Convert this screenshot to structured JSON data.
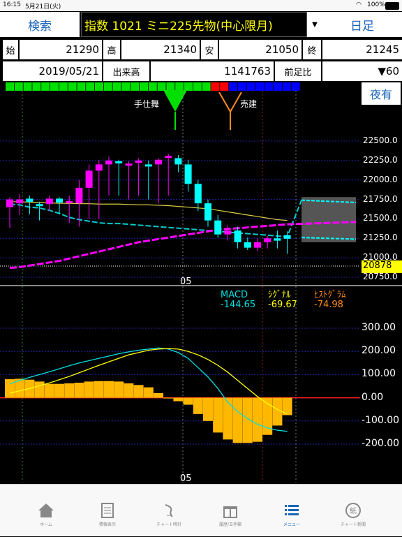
{
  "status_bar": {
    "time": "16:15",
    "date": "5月21日(火)",
    "battery": "100%"
  },
  "header": {
    "search_label": "検索",
    "instrument": "指数 1021 ミニ225先物(中心限月)",
    "period_label": "日足"
  },
  "quote": {
    "open_label": "始",
    "open": "21290",
    "high_label": "高",
    "high": "21340",
    "low_label": "安",
    "low": "21050",
    "close_label": "終",
    "close": "21245",
    "date": "2019/05/21",
    "volume_label": "出来高",
    "volume": "1141763",
    "change_label": "前足比",
    "change": "▼60"
  },
  "night_button": "夜有",
  "signals": {
    "buy": "手仕舞",
    "sell": "売建"
  },
  "price_chart": {
    "y_ticks": [
      "22500.0",
      "22250.0",
      "22000.0",
      "21750.0",
      "21500.0",
      "21250.0",
      "21000.0",
      "20750.0"
    ],
    "current_price": "20878",
    "x_label": "05"
  },
  "macd_panel": {
    "macd_label": "MACD",
    "macd_value": "-144.65",
    "signal_label": "ｼｸﾞﾅﾙ",
    "signal_value": "-69.67",
    "hist_label": "ﾋｽﾄｸﾞﾗﾑ",
    "hist_value": "-74.98",
    "y_ticks": [
      "300.00",
      "200.00",
      "100.00",
      "0.00",
      "-100.00",
      "-200.00"
    ],
    "x_label": "05"
  },
  "colors": {
    "accent": "#1a64b8",
    "macd": "#00e0e0",
    "signal": "#ffff00",
    "histogram": "#ffb800",
    "up_candle": "#ff00ff",
    "down_candle": "#00ffff"
  },
  "tabs": [
    {
      "label": "ホーム",
      "icon": "home-icon"
    },
    {
      "label": "情報表示",
      "icon": "document-icon"
    },
    {
      "label": "チャート時計",
      "icon": "chart-clock-icon"
    },
    {
      "label": "履歴/玉手箱",
      "icon": "gift-box-icon"
    },
    {
      "label": "メニュー",
      "icon": "menu-list-icon"
    },
    {
      "label": "チャート新聞",
      "icon": "newspaper-icon"
    }
  ],
  "chart_data": [
    {
      "type": "candlestick",
      "title": "",
      "ylim": [
        20750,
        22500
      ],
      "y_ticks": [
        22500,
        22250,
        22000,
        21750,
        21500,
        21250,
        21000,
        20750
      ],
      "x_tick_labels": [
        "05"
      ],
      "current_price": 20878,
      "candles": [
        {
          "open": 21650,
          "high": 21780,
          "low": 21380,
          "close": 21750
        },
        {
          "open": 21700,
          "high": 21820,
          "low": 21550,
          "close": 21750
        },
        {
          "open": 21760,
          "high": 21800,
          "low": 21560,
          "close": 21720
        },
        {
          "open": 21690,
          "high": 21720,
          "low": 21480,
          "close": 21680
        },
        {
          "open": 21690,
          "high": 21800,
          "low": 21600,
          "close": 21760
        },
        {
          "open": 21760,
          "high": 21780,
          "low": 21560,
          "close": 21710
        },
        {
          "open": 21720,
          "high": 21800,
          "low": 21450,
          "close": 21730
        },
        {
          "open": 21700,
          "high": 22000,
          "low": 21400,
          "close": 21900
        },
        {
          "open": 21900,
          "high": 22200,
          "low": 21500,
          "close": 22120
        },
        {
          "open": 22120,
          "high": 22260,
          "low": 21500,
          "close": 22200
        },
        {
          "open": 22200,
          "high": 22300,
          "low": 21800,
          "close": 22250
        },
        {
          "open": 22240,
          "high": 22260,
          "low": 21800,
          "close": 22220
        },
        {
          "open": 22200,
          "high": 22240,
          "low": 21750,
          "close": 22210
        },
        {
          "open": 22220,
          "high": 22280,
          "low": 21800,
          "close": 22250
        },
        {
          "open": 22200,
          "high": 22250,
          "low": 21750,
          "close": 22180
        },
        {
          "open": 22200,
          "high": 22280,
          "low": 21700,
          "close": 22260
        },
        {
          "open": 22290,
          "high": 22340,
          "low": 21800,
          "close": 22310
        },
        {
          "open": 22280,
          "high": 22320,
          "low": 22100,
          "close": 22200
        },
        {
          "open": 22200,
          "high": 22260,
          "low": 21850,
          "close": 21950
        },
        {
          "open": 21950,
          "high": 22000,
          "low": 21600,
          "close": 21700
        },
        {
          "open": 21700,
          "high": 21750,
          "low": 21400,
          "close": 21480
        },
        {
          "open": 21480,
          "high": 21550,
          "low": 21260,
          "close": 21300
        },
        {
          "open": 21300,
          "high": 21420,
          "low": 21220,
          "close": 21350
        },
        {
          "open": 21350,
          "high": 21400,
          "low": 21120,
          "close": 21200
        },
        {
          "open": 21200,
          "high": 21260,
          "low": 21100,
          "close": 21130
        },
        {
          "open": 21130,
          "high": 21250,
          "low": 21080,
          "close": 21200
        },
        {
          "open": 21200,
          "high": 21280,
          "low": 21120,
          "close": 21250
        },
        {
          "open": 21250,
          "high": 21350,
          "low": 21120,
          "close": 21220
        },
        {
          "open": 21290,
          "high": 21340,
          "low": 21050,
          "close": 21245
        }
      ],
      "moving_average": [
        21720,
        21720,
        21715,
        21710,
        21705,
        21700,
        21700,
        21695,
        21695,
        21690,
        21690,
        21690,
        21685,
        21680,
        21680,
        21675,
        21670,
        21660,
        21650,
        21640,
        21630,
        21610,
        21590,
        21570,
        21550,
        21530,
        21510,
        21490,
        21480
      ],
      "lower_band_up": [
        20870,
        20880,
        20900,
        20920,
        20940,
        20960,
        20990,
        21020,
        21050,
        21080,
        21110,
        21140,
        21170,
        21200,
        21220,
        21240,
        21260,
        21280,
        21300,
        21320,
        21340,
        21360,
        21370,
        21380,
        21390,
        21400,
        21410,
        21420,
        21430
      ],
      "ichimoku_cloud_lines": [
        21690,
        21680,
        21650,
        21640,
        21610,
        21570,
        21520,
        21490,
        21470,
        21450,
        21440,
        21440,
        21430,
        21420,
        21410,
        21400,
        21390,
        21380,
        21370,
        21360,
        21350,
        21340,
        21330,
        21320,
        21310,
        21300,
        21290,
        21280,
        21270
      ]
    },
    {
      "type": "bar",
      "title": "",
      "ylim": [
        -200,
        300
      ],
      "y_ticks": [
        300,
        200,
        100,
        0,
        -100,
        -200
      ],
      "x_tick_labels": [
        "05"
      ],
      "series": [
        {
          "name": "MACD",
          "values": [
            60,
            75,
            88,
            100,
            112,
            125,
            138,
            150,
            160,
            170,
            180,
            190,
            198,
            205,
            210,
            215,
            210,
            195,
            170,
            130,
            90,
            40,
            -20,
            -60,
            -90,
            -115,
            -130,
            -140,
            -145
          ]
        },
        {
          "name": "ｼｸﾞﾅﾙ",
          "values": [
            20,
            30,
            40,
            52,
            64,
            78,
            92,
            108,
            124,
            140,
            155,
            170,
            185,
            195,
            205,
            210,
            212,
            210,
            200,
            185,
            165,
            140,
            110,
            75,
            40,
            5,
            -25,
            -50,
            -70
          ]
        },
        {
          "name": "ﾋｽﾄｸﾞﾗﾑ",
          "values": [
            80,
            82,
            78,
            70,
            60,
            60,
            62,
            65,
            70,
            72,
            72,
            70,
            62,
            55,
            45,
            20,
            0,
            -15,
            -30,
            -70,
            -100,
            -150,
            -180,
            -195,
            -195,
            -190,
            -160,
            -120,
            -75
          ]
        }
      ]
    }
  ]
}
